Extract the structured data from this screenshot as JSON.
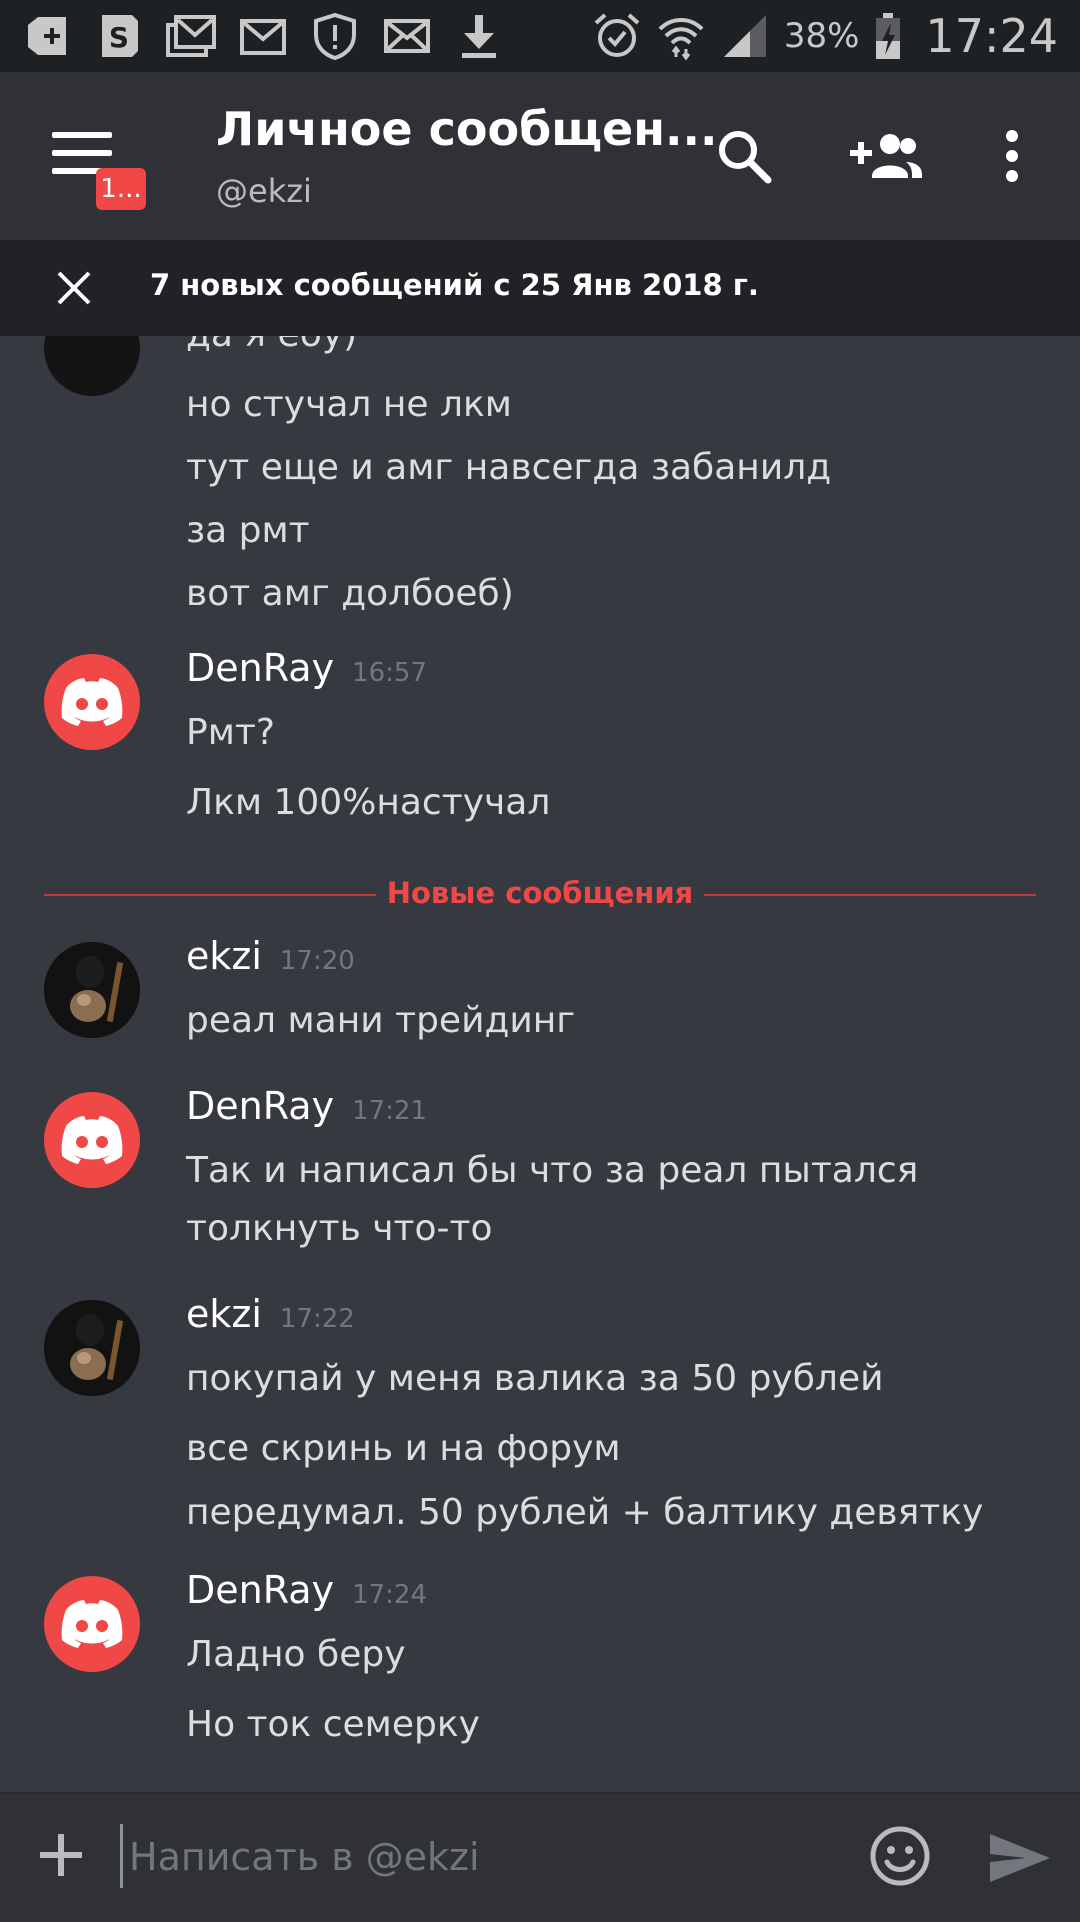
{
  "status_bar": {
    "battery": "38%",
    "time": "17:24",
    "icons": [
      "add-box-icon",
      "skype-icon",
      "gmail-stack-icon",
      "gmail-icon",
      "shield-alert-icon",
      "mail-icon",
      "download-icon",
      "alarm-icon",
      "wifi-icon",
      "signal-icon",
      "battery-icon"
    ]
  },
  "header": {
    "menu_badge": "1...",
    "title": "Личное сообщен...",
    "subtitle": "@ekzi",
    "icons": [
      "menu-icon",
      "search-icon",
      "add-friend-icon",
      "more-vert-icon"
    ]
  },
  "notice": {
    "text": "7 новых сообщений с 25 Янв 2018 г."
  },
  "messages": {
    "partial_line": "да я ебу)",
    "group0_lines": [
      "но стучал не лкм",
      "тут еще и амг навсегда забанилд",
      "за рмт",
      "вот амг долбоеб)"
    ],
    "g1": {
      "author": "DenRay",
      "time": "16:57",
      "lines": [
        "Рмт?",
        "Лкм 100%настучал"
      ]
    },
    "divider": "Новые сообщения",
    "g2": {
      "author": "ekzi",
      "time": "17:20",
      "lines": [
        "реал мани трейдинг"
      ]
    },
    "g3": {
      "author": "DenRay",
      "time": "17:21",
      "lines": [
        "Так и написал бы что за реал пытался",
        "толкнуть что-то"
      ]
    },
    "g4": {
      "author": "ekzi",
      "time": "17:22",
      "lines": [
        "покупай у меня валика за 50 рублей",
        "все скринь и на форум",
        "передумал. 50 рублей + балтику девятку"
      ]
    },
    "g5": {
      "author": "DenRay",
      "time": "17:24",
      "lines": [
        "Ладно беру",
        "Но ток семерку"
      ]
    }
  },
  "composer": {
    "placeholder": "Написать в @ekzi",
    "value": ""
  },
  "colors": {
    "background": "#36393f",
    "header": "#2f3136",
    "notice": "#202225",
    "accent_red": "#f04747",
    "text": "#dcddde",
    "timestamp": "#72767d"
  }
}
